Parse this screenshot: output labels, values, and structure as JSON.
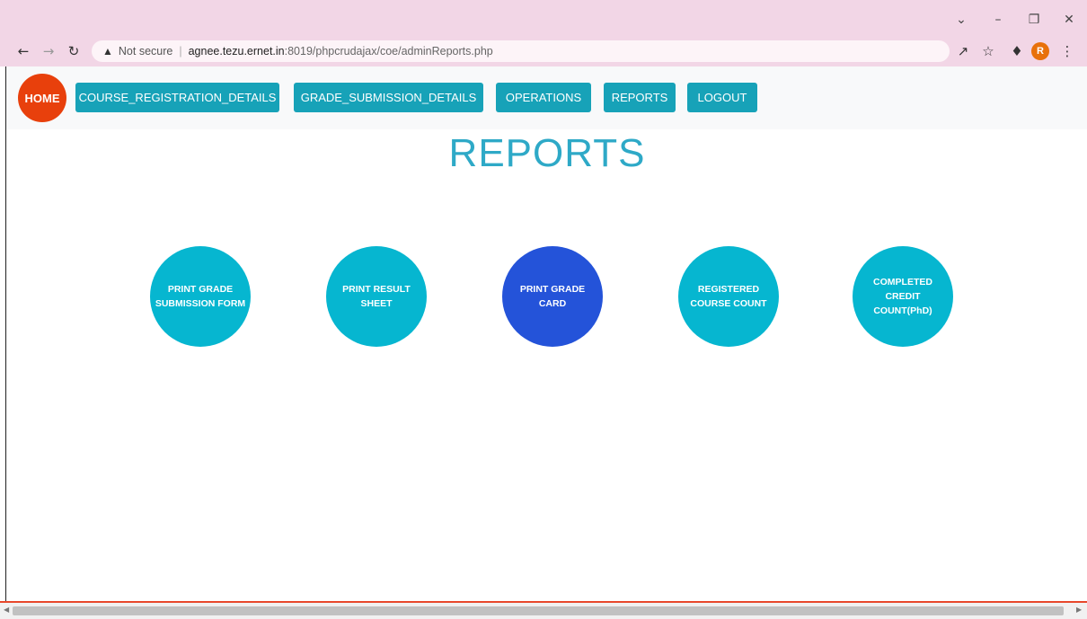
{
  "browser": {
    "url_warning_icon": "warning-triangle-icon",
    "not_secure_label": "Not secure",
    "url_host": "agnee.tezu.ernet.in",
    "url_path": ":8019/phpcrudajax/coe/adminReports.php",
    "profile_initial": "R",
    "profile_color": "#e8710a"
  },
  "nav": {
    "home_label": "HOME",
    "buttons": [
      "COURSE_REGISTRATION_DETAILS",
      "GRADE_SUBMISSION_DETAILS",
      "OPERATIONS",
      "REPORTS",
      "LOGOUT"
    ]
  },
  "page": {
    "title": "REPORTS",
    "report_options": [
      "PRINT GRADE SUBMISSION FORM",
      "PRINT RESULT SHEET",
      "PRINT GRADE CARD",
      "REGISTERED COURSE COUNT",
      "COMPLETED CREDIT COUNT(PhD)"
    ],
    "active_option_index": 2
  },
  "colors": {
    "nav_button": "#17a2b8",
    "home_button": "#e8400c",
    "circle": "#06b6d0",
    "circle_active": "#2453d9",
    "title": "#2ea9c7"
  }
}
